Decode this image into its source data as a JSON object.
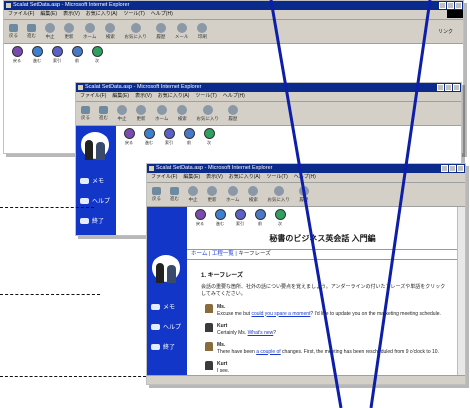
{
  "window": {
    "title": "Scalat SetData.asp - Microsoft Internet Explorer",
    "menu": [
      "ファイル(F)",
      "編集(E)",
      "表示(V)",
      "お気に入り(A)",
      "ツール(T)",
      "ヘルプ(H)"
    ],
    "toolbar": [
      "戻る",
      "進む",
      "中止",
      "更新",
      "ホーム",
      "検索",
      "お気に入り",
      "履歴",
      "メール",
      "印刷"
    ],
    "nav_buttons": [
      "戻る",
      "進む",
      "索引",
      "前",
      "次"
    ],
    "link_text": "リンク"
  },
  "sidebar": {
    "items": [
      "メモ",
      "ヘルプ",
      "終了"
    ]
  },
  "page": {
    "title": "秘書のビジネス英会話 入門編",
    "breadcrumb": [
      "ホーム",
      "工程一覧",
      "キーフレーズ"
    ],
    "section_title": "1. キーフレーズ",
    "intro": "会話の重要な箇所、社外の話につい要点を覚えましょう。アンダーラインの付いたフレーズや単語をクリックしてみてください。",
    "dialog": [
      {
        "speaker": "Ms.",
        "text_before": "Excuse me but ",
        "link": "could you spare a moment",
        "text_after": "? I'd like to update you on the marketing meeting schedule."
      },
      {
        "speaker": "Kurt",
        "text_before": "Certainly Ms. ",
        "link": "What's new",
        "text_after": "?"
      },
      {
        "speaker": "Ms.",
        "text_before": "There have been ",
        "link": "a couple of",
        "text_after": " changes. First, the meeting has been rescheduled from 9 o'clock to 10."
      },
      {
        "speaker": "Kurt",
        "text_before": "I see.",
        "link": "",
        "text_after": ""
      }
    ]
  }
}
